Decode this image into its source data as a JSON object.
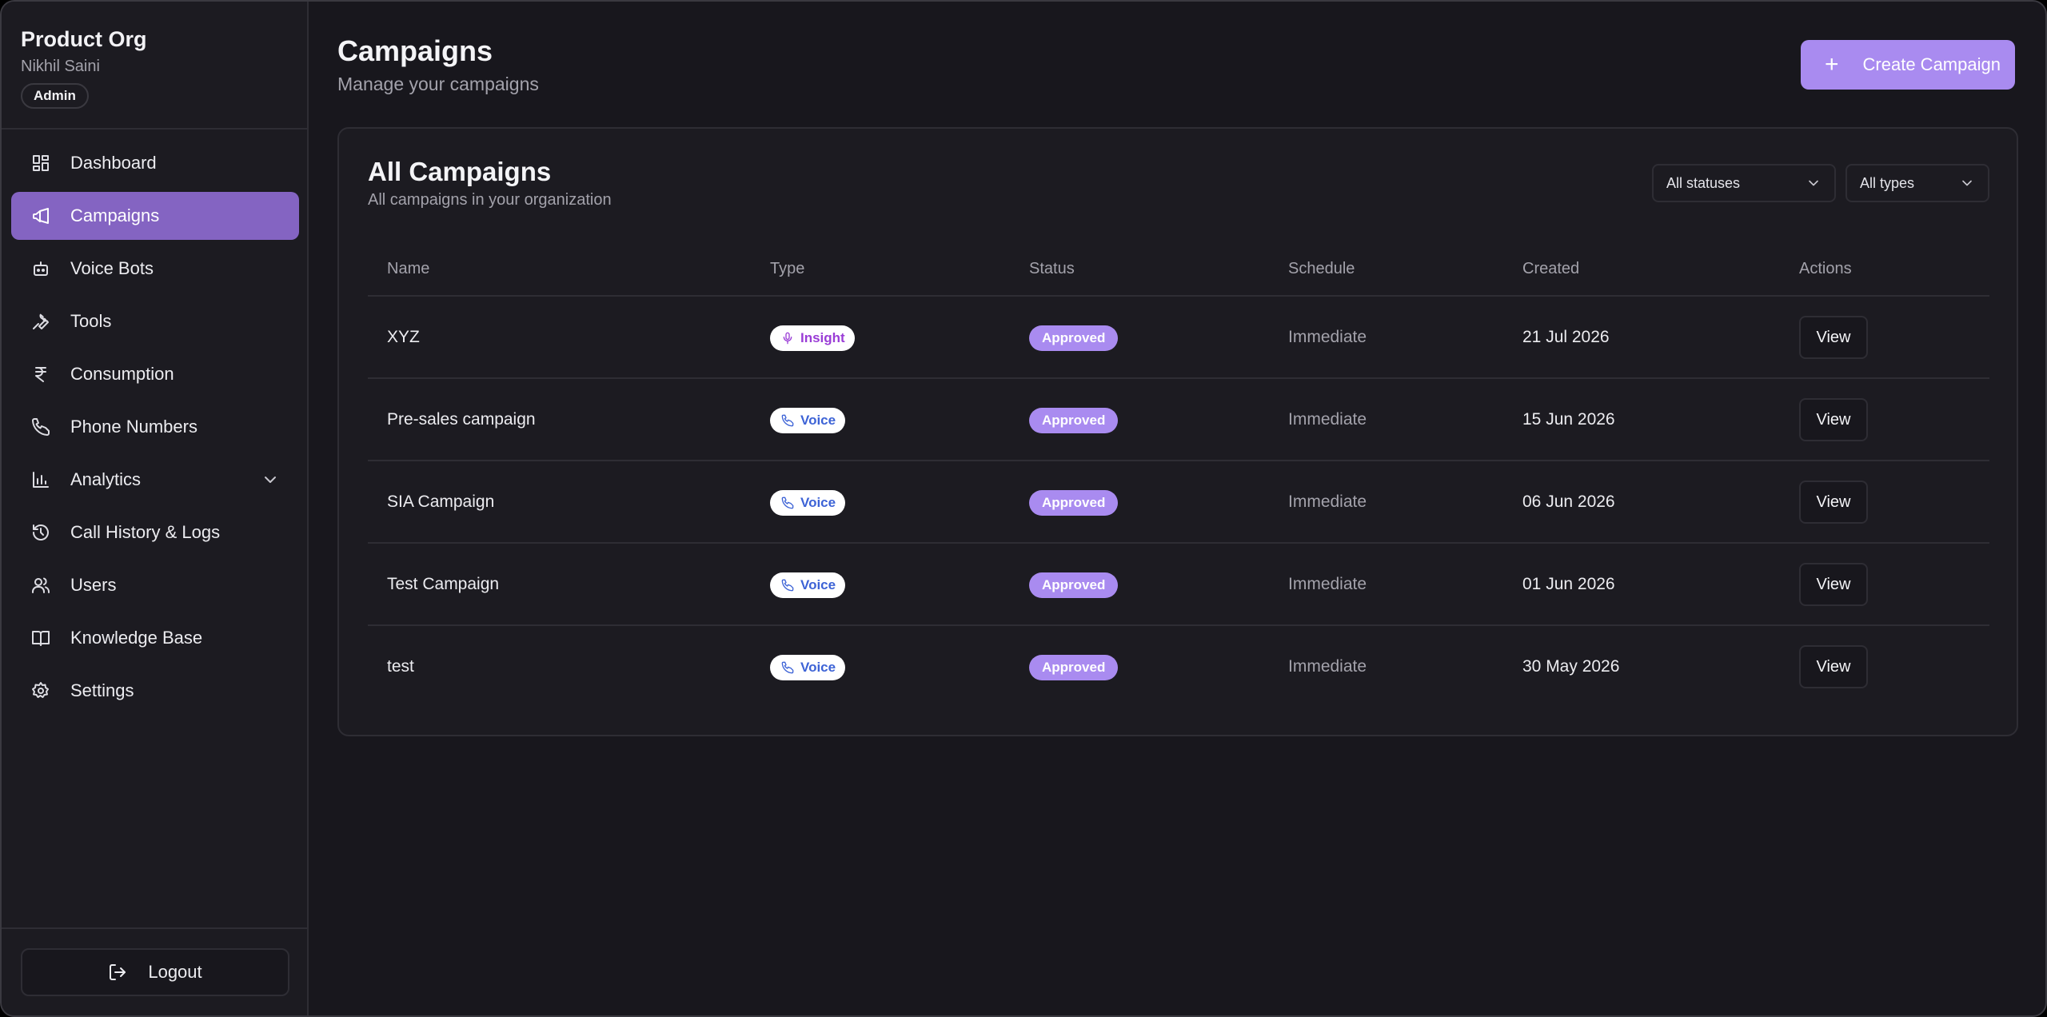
{
  "sidebar": {
    "org_name": "Product Org",
    "user_name": "Nikhil Saini",
    "role": "Admin",
    "items": [
      {
        "label": "Dashboard",
        "icon": "dashboard-icon"
      },
      {
        "label": "Campaigns",
        "icon": "megaphone-icon",
        "active": true
      },
      {
        "label": "Voice Bots",
        "icon": "bot-icon"
      },
      {
        "label": "Tools",
        "icon": "wrench-icon"
      },
      {
        "label": "Consumption",
        "icon": "rupee-icon"
      },
      {
        "label": "Phone Numbers",
        "icon": "phone-icon"
      },
      {
        "label": "Analytics",
        "icon": "bar-chart-icon",
        "expandable": true
      },
      {
        "label": "Call History & Logs",
        "icon": "history-icon"
      },
      {
        "label": "Users",
        "icon": "users-icon"
      },
      {
        "label": "Knowledge Base",
        "icon": "book-icon"
      },
      {
        "label": "Settings",
        "icon": "gear-icon"
      }
    ],
    "logout_label": "Logout"
  },
  "header": {
    "title": "Campaigns",
    "subtitle": "Manage your campaigns",
    "create_label": "Create Campaign"
  },
  "card": {
    "title": "All Campaigns",
    "subtitle": "All campaigns in your organization",
    "status_filter": "All statuses",
    "type_filter": "All types"
  },
  "table": {
    "columns": [
      "Name",
      "Type",
      "Status",
      "Schedule",
      "Created",
      "Actions"
    ],
    "rows": [
      {
        "name": "XYZ",
        "type": "Insight",
        "status": "Approved",
        "schedule": "Immediate",
        "created": "21 Jul 2026",
        "action": "View"
      },
      {
        "name": "Pre-sales campaign",
        "type": "Voice",
        "status": "Approved",
        "schedule": "Immediate",
        "created": "15 Jun 2026",
        "action": "View"
      },
      {
        "name": "SIA Campaign",
        "type": "Voice",
        "status": "Approved",
        "schedule": "Immediate",
        "created": "06 Jun 2026",
        "action": "View"
      },
      {
        "name": "Test Campaign",
        "type": "Voice",
        "status": "Approved",
        "schedule": "Immediate",
        "created": "01 Jun 2026",
        "action": "View"
      },
      {
        "name": "test",
        "type": "Voice",
        "status": "Approved",
        "schedule": "Immediate",
        "created": "30 May 2026",
        "action": "View"
      }
    ]
  },
  "colors": {
    "accent": "#a98bf0",
    "active_nav": "#8464c2",
    "background": "#18171d",
    "insight_text": "#9a3dd6",
    "voice_text": "#3d63d6"
  }
}
